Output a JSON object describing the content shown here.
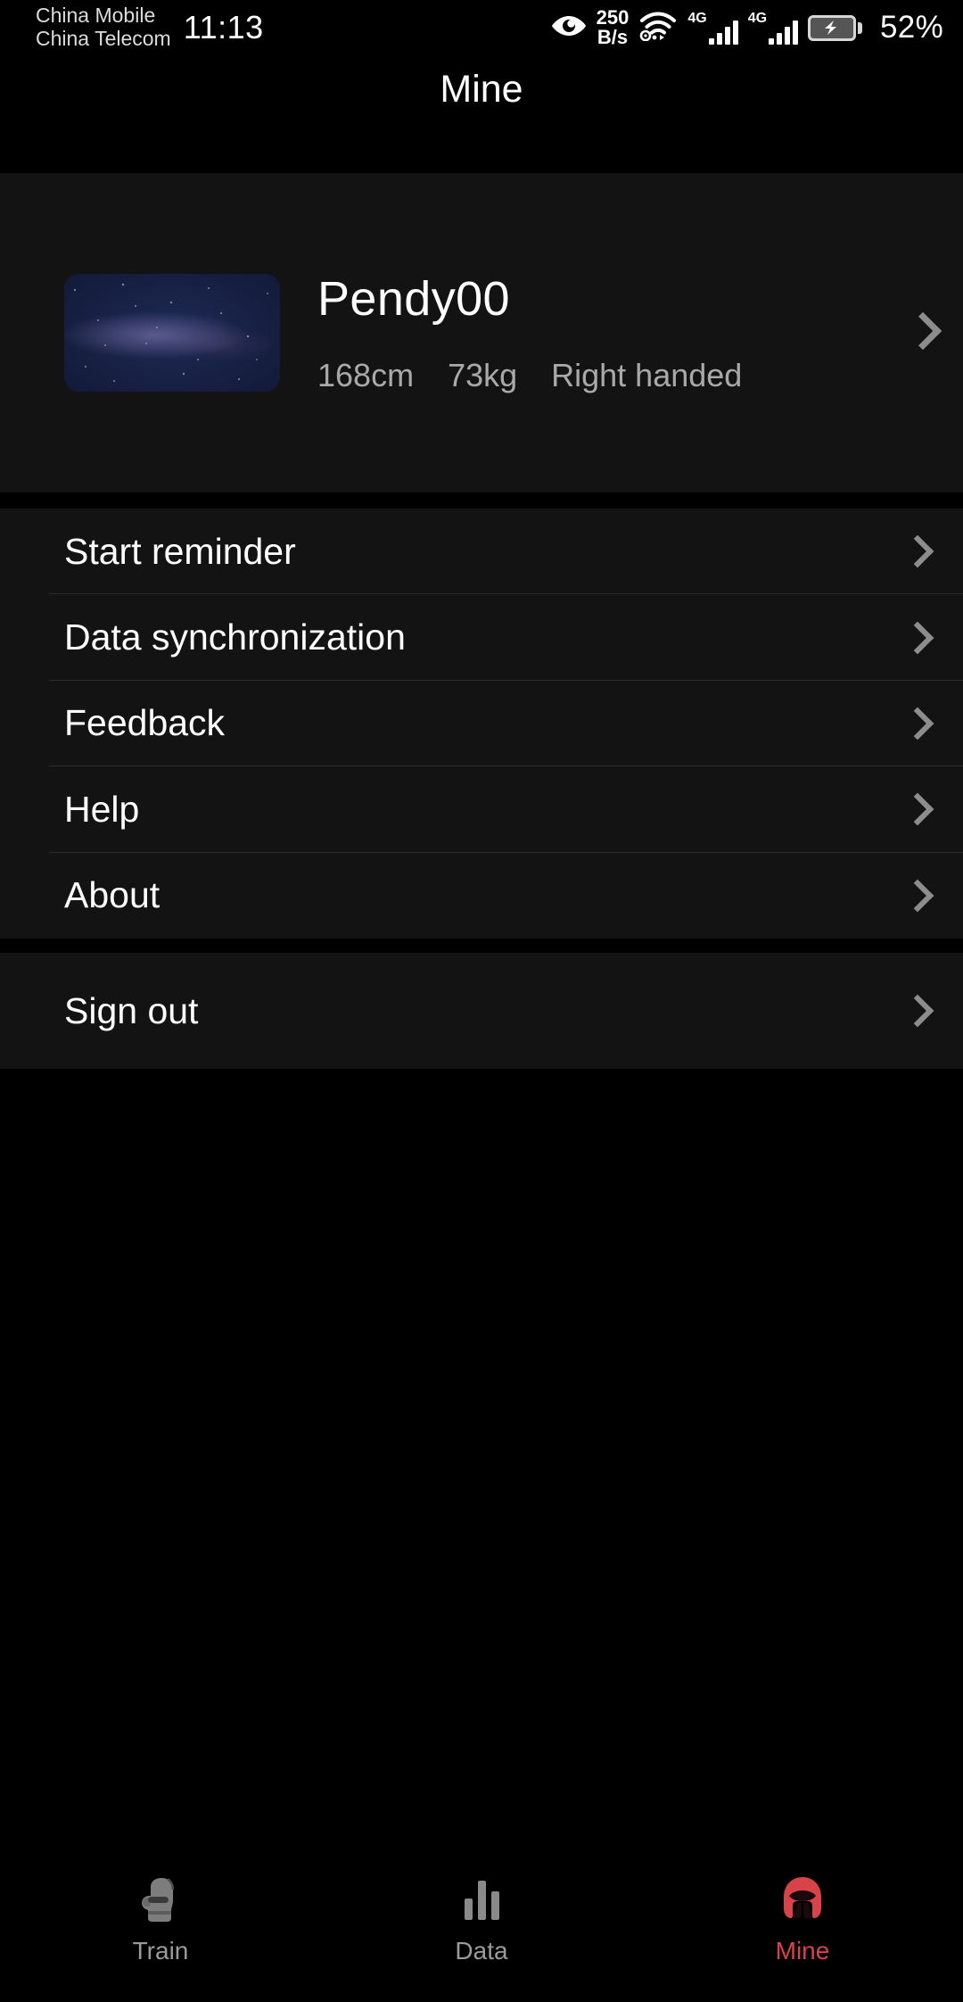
{
  "status_bar": {
    "carrier_primary": "China Mobile",
    "carrier_secondary": "China Telecom",
    "time": "11:13",
    "eye_icon": "eye-icon",
    "net_speed_value": "250",
    "net_speed_unit": "B/s",
    "wifi_icon": "wifi-icon",
    "hotspot_icon": "hotspot-icon",
    "signal_1_label": "4G",
    "signal_2_label": "4G",
    "battery_icon": "battery-charging-icon",
    "battery_percent": "52%"
  },
  "header": {
    "title": "Mine"
  },
  "profile": {
    "avatar_icon": "starfield-avatar",
    "username": "Pendy00",
    "stats": [
      "168cm",
      "73kg",
      "Right handed"
    ],
    "chevron_icon": "chevron-right-icon"
  },
  "menu": {
    "main_items": [
      {
        "label": "Start reminder",
        "chevron_icon": "chevron-right-icon"
      },
      {
        "label": "Data synchronization",
        "chevron_icon": "chevron-right-icon"
      },
      {
        "label": "Feedback",
        "chevron_icon": "chevron-right-icon"
      },
      {
        "label": "Help",
        "chevron_icon": "chevron-right-icon"
      },
      {
        "label": "About",
        "chevron_icon": "chevron-right-icon"
      }
    ],
    "signout": {
      "label": "Sign out",
      "chevron_icon": "chevron-right-icon"
    }
  },
  "bottom_nav": {
    "items": [
      {
        "label": "Train",
        "icon": "boxing-glove-icon",
        "active": false
      },
      {
        "label": "Data",
        "icon": "bar-chart-icon",
        "active": false
      },
      {
        "label": "Mine",
        "icon": "boxing-headgear-icon",
        "active": true
      }
    ],
    "active_color": "#d8434a",
    "inactive_color": "#8a8a8a"
  }
}
